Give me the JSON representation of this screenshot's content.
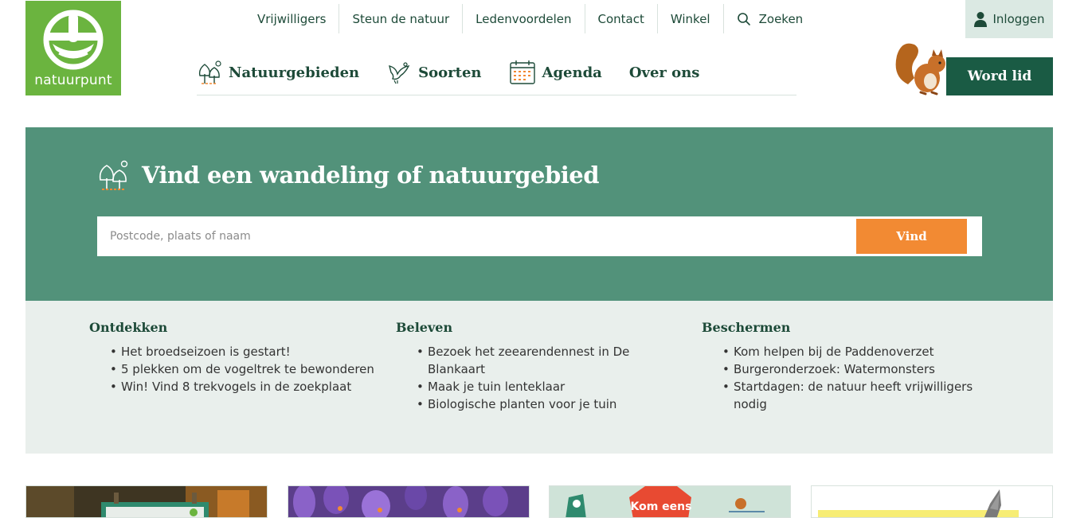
{
  "logo": {
    "text": "natuurpunt",
    "brand_color": "#6bb43f"
  },
  "topnav": {
    "items": [
      "Vrijwilligers",
      "Steun de natuur",
      "Ledenvoordelen",
      "Contact",
      "Winkel"
    ],
    "search_label": "Zoeken",
    "search_icon": "search-icon"
  },
  "login": {
    "label": "Inloggen",
    "icon": "user-icon"
  },
  "mainnav": {
    "items": [
      {
        "label": "Natuurgebieden",
        "icon": "trees-icon"
      },
      {
        "label": "Soorten",
        "icon": "bird-icon"
      },
      {
        "label": "Agenda",
        "icon": "calendar-icon"
      },
      {
        "label": "Over ons",
        "icon": ""
      }
    ]
  },
  "cta": {
    "label": "Word lid",
    "color": "#1a5b44"
  },
  "hero": {
    "title": "Vind een wandeling of natuurgebied",
    "placeholder": "Postcode, plaats of naam",
    "button": "Vind",
    "bg_color": "#52927a",
    "button_color": "#f28a33"
  },
  "columns": [
    {
      "heading": "Ontdekken",
      "items": [
        "Het broedseizoen is gestart!",
        "5 plekken om de vogeltrek te bewonderen",
        "Win! Vind 8 trekvogels in de zoekplaat"
      ]
    },
    {
      "heading": "Beleven",
      "items": [
        "Bezoek het zeearendennest in De Blankaart",
        "Maak je tuin lenteklaar",
        "Biologische planten voor je tuin"
      ]
    },
    {
      "heading": "Beschermen",
      "items": [
        "Kom helpen bij de Paddenoverzet",
        "Burgeronderzoek: Watermonsters",
        "Startdagen: de natuur heeft vrijwilligers nodig"
      ]
    }
  ],
  "cards": [
    {
      "image": "forest-sign-photo"
    },
    {
      "image": "crocus-flowers-photo"
    },
    {
      "image": "illustration-kom-eens",
      "text": "Kom eens"
    },
    {
      "image": "bird-wing-photo"
    }
  ]
}
